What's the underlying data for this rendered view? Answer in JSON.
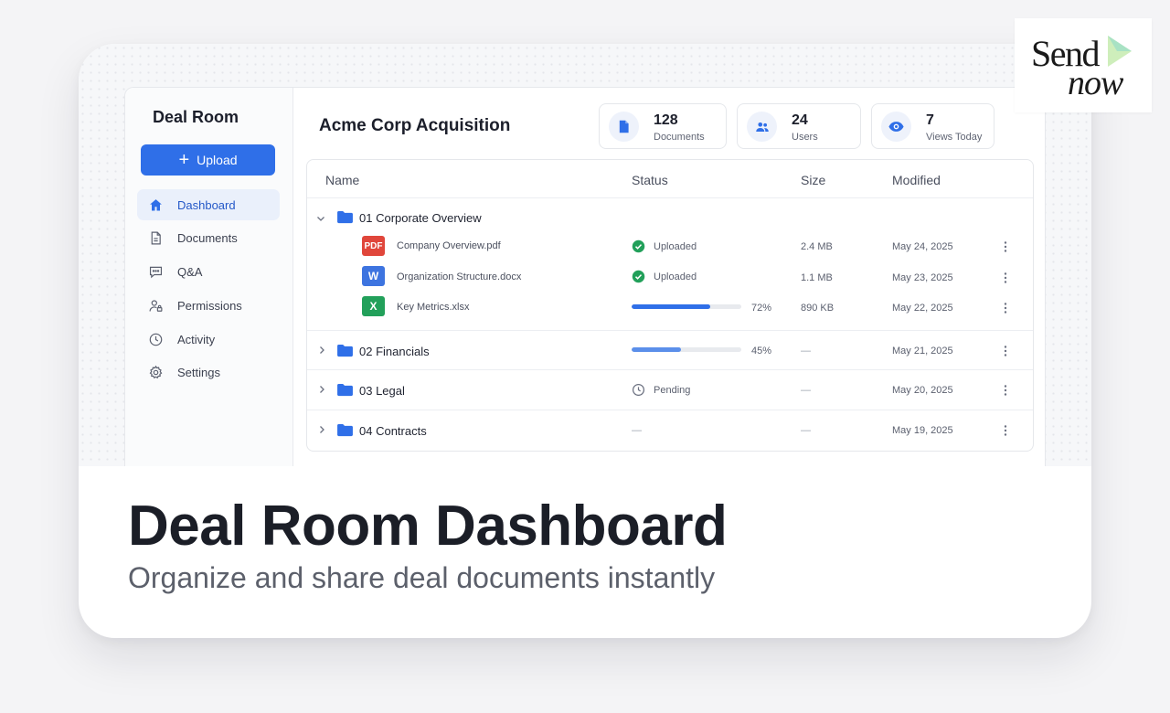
{
  "sidebar": {
    "title": "Deal Room",
    "upload_label": "Upload",
    "items": [
      {
        "label": "Dashboard",
        "icon": "home-icon",
        "active": true
      },
      {
        "label": "Documents",
        "icon": "document-icon"
      },
      {
        "label": "Q&A",
        "icon": "chat-icon"
      },
      {
        "label": "Permissions",
        "icon": "user-lock-icon"
      },
      {
        "label": "Activity",
        "icon": "clock-icon"
      },
      {
        "label": "Settings",
        "icon": "gear-icon"
      }
    ]
  },
  "main": {
    "title": "Acme Corp Acquisition",
    "stats": [
      {
        "value": "128",
        "label": "Documents",
        "icon": "file-icon"
      },
      {
        "value": "24",
        "label": "Users",
        "icon": "users-icon"
      },
      {
        "value": "7",
        "label": "Views Today",
        "icon": "eye-icon"
      }
    ]
  },
  "table": {
    "columns": [
      "Name",
      "Status",
      "Size",
      "Modified"
    ],
    "folders": [
      {
        "name": "01 Corporate Overview",
        "expanded": true,
        "files": [
          {
            "type_label": "PDF",
            "type_color": "#e0463b",
            "name": "Company Overview.pdf",
            "status": "Uploaded",
            "size": "2.4 MB",
            "modified": "May 24, 2025"
          },
          {
            "type_label": "W",
            "type_color": "#3d74e0",
            "name": "Organization Structure.docx",
            "status": "Uploaded",
            "size": "1.1 MB",
            "modified": "May 23, 2025"
          },
          {
            "type_label": "X",
            "type_color": "#22a05a",
            "name": "Key Metrics.xlsx",
            "progress": 72,
            "progress_label": "72%",
            "size": "890 KB",
            "modified": "May 22, 2025"
          }
        ]
      },
      {
        "name": "02 Financials",
        "expanded": false,
        "progress": 45,
        "progress_label": "45%",
        "size": "—",
        "modified": "May 21, 2025"
      },
      {
        "name": "03 Legal",
        "expanded": false,
        "status": "Pending",
        "size": "—",
        "modified": "May 20, 2025"
      },
      {
        "name": "04 Contracts",
        "expanded": false,
        "status": "—",
        "size": "—",
        "modified": "May 19, 2025"
      }
    ]
  },
  "hero": {
    "title": "Deal Room Dashboard",
    "subtitle": "Organize and share deal documents instantly"
  },
  "logo": {
    "line1": "Send",
    "line2": "now"
  },
  "colors": {
    "accent": "#2f6fe8",
    "success": "#22a05a",
    "pdf": "#e0463b"
  }
}
